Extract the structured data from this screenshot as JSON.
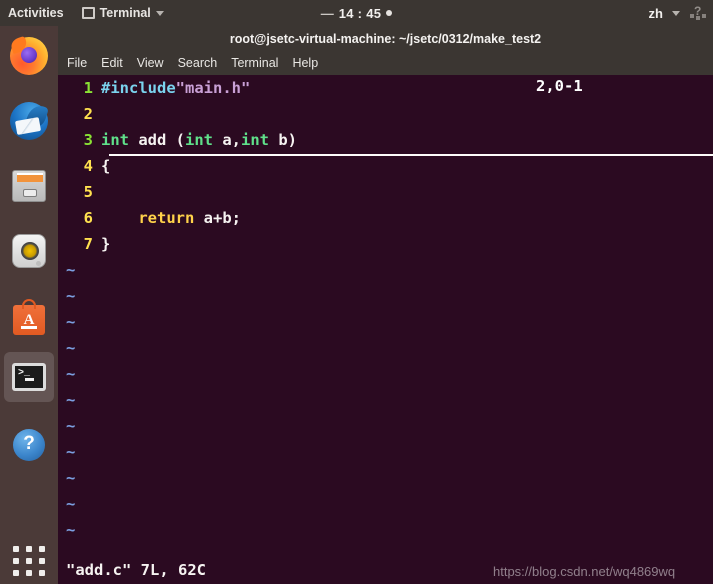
{
  "topbar": {
    "activities": "Activities",
    "app_name": "Terminal",
    "app_icon": "terminal-icon",
    "clock": "14 : 45",
    "clock_dash": "—",
    "input_method": "zh",
    "system_icon": "system-status-icon"
  },
  "dock": {
    "items": [
      {
        "name": "firefox",
        "label": "Firefox Web Browser",
        "active": false
      },
      {
        "name": "thunderbird",
        "label": "Thunderbird Mail",
        "active": false
      },
      {
        "name": "files",
        "label": "Files",
        "active": false
      },
      {
        "name": "rhythmbox",
        "label": "Rhythmbox",
        "active": false
      },
      {
        "name": "ubuntu-software",
        "label": "Ubuntu Software",
        "active": false
      },
      {
        "name": "terminal",
        "label": "Terminal",
        "active": true
      },
      {
        "name": "help",
        "label": "Help",
        "active": false
      }
    ],
    "show_applications": "Show Applications"
  },
  "window": {
    "title": "root@jsetc-virtual-machine: ~/jsetc/0312/make_test2",
    "menu": [
      "File",
      "Edit",
      "View",
      "Search",
      "Terminal",
      "Help"
    ]
  },
  "editor": {
    "app": "vim",
    "lines": [
      {
        "num": "1",
        "num_style": "alt",
        "tokens": [
          {
            "t": "#include",
            "c": "tk-pre"
          },
          {
            "t": "\"main.h\"",
            "c": "tk-str"
          }
        ]
      },
      {
        "num": "2",
        "num_style": "normal",
        "tokens": []
      },
      {
        "num": "3",
        "num_style": "alt",
        "tokens": [
          {
            "t": "int",
            "c": "tk-type"
          },
          {
            "t": " add ",
            "c": "tk-plain"
          },
          {
            "t": "(",
            "c": "tk-plain"
          },
          {
            "t": "int",
            "c": "tk-type"
          },
          {
            "t": " a,",
            "c": "tk-plain"
          },
          {
            "t": "int",
            "c": "tk-type"
          },
          {
            "t": " b)",
            "c": "tk-plain"
          }
        ]
      },
      {
        "num": "4",
        "num_style": "normal",
        "tokens": [
          {
            "t": "{",
            "c": "tk-plain"
          }
        ]
      },
      {
        "num": "5",
        "num_style": "normal",
        "tokens": []
      },
      {
        "num": "6",
        "num_style": "normal",
        "tokens": [
          {
            "t": "    ",
            "c": "tk-plain"
          },
          {
            "t": "return",
            "c": "tk-kw"
          },
          {
            "t": " a+b;",
            "c": "tk-plain"
          }
        ]
      },
      {
        "num": "7",
        "num_style": "normal",
        "tokens": [
          {
            "t": "}",
            "c": "tk-plain"
          }
        ]
      }
    ],
    "empty_marker": "~",
    "empty_marker_count": 11,
    "cursor": {
      "line": 2,
      "column": 0
    },
    "status_file": "\"add.c\" 7L, 62C",
    "status_position": "2,0-1"
  },
  "watermark": "https://blog.csdn.net/wq4869wq",
  "colors": {
    "terminal_bg": "#2b0a21",
    "dock_bg": "#4b3a38",
    "topbar_bg": "#3b3632",
    "titlebar_bg": "#3b3632",
    "linenum_yellow": "#ffe14f",
    "linenum_green": "#8ae234",
    "preproc_cyan": "#7ad3ee",
    "string_mauve": "#c9a0d6",
    "type_green": "#5fe08a",
    "keyword_yellow": "#ffd24a",
    "text_white": "#f6f3f1",
    "tilde_blue": "#7b9fe0"
  }
}
